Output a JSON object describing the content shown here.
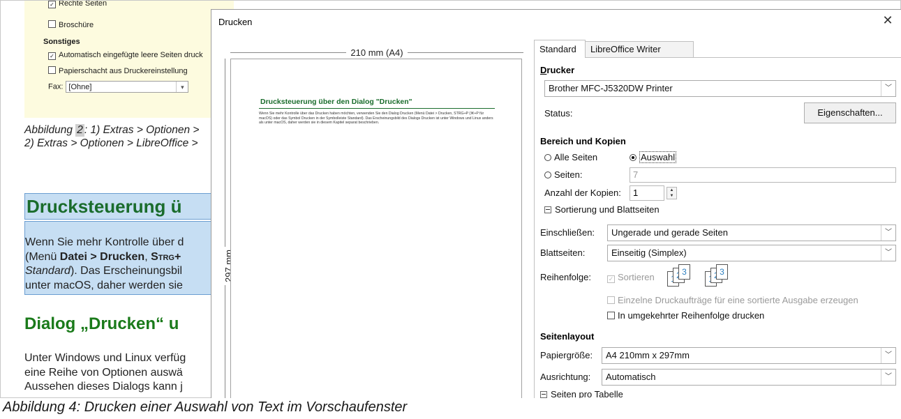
{
  "background_doc": {
    "embedded_options": {
      "right_pages_label": "Rechte Seiten",
      "brochure_label": "Broschüre",
      "misc_heading": "Sonstiges",
      "auto_blank_label": "Automatisch eingefügte leere Seiten druck",
      "paper_tray_label": "Papierschacht aus Druckereinstellung",
      "fax_label": "Fax:",
      "fax_value": "[Ohne]"
    },
    "figure2_caption_line1_a": "Abbildung ",
    "figure2_caption_num": "2",
    "figure2_caption_line1_b": ": 1) Extras > Optionen >",
    "figure2_caption_line2": "2) Extras > Optionen > LibreOffice >",
    "heading_drucksteuerung": "Drucksteuerung ü",
    "para_sel_line1": "Wenn Sie mehr Kontrolle über d",
    "para_sel_line2_a": "(Menü ",
    "para_sel_line2_b": "Datei > Drucken",
    "para_sel_line2_c": ", ",
    "para_sel_line2_d": "Strg+",
    "para_sel_line3_a": "Standard",
    "para_sel_line3_b": "). Das Erscheinungsbil",
    "para_sel_line4": "unter macOS, daher werden sie",
    "heading_dialog": "Dialog „Drucken“ u",
    "para_under_line1": "Unter Windows und Linux verfüg",
    "para_under_line2": "eine Reihe von Optionen auswä",
    "para_under_line3": "Aussehen dieses Dialogs kann j"
  },
  "bottom_caption": "Abbildung 4: Drucken einer Auswahl von Text im Vorschaufenster",
  "dialog": {
    "title": "Drucken",
    "close_glyph": "✕",
    "preview": {
      "width_label": "210 mm (A4)",
      "height_label": "297 mm",
      "mini_heading": "Drucksteuerung über den Dialog \"Drucken\"",
      "mini_text": "Wenn Sie mehr Kontrolle über das Drucken haben möchten, verwenden Sie den Dialog Drucken (Menü Datei > Drucken, STRG+P (⌘+P für macOS) oder das Symbol Drucken in der Symbolleiste Standard). Das Erscheinungsbild des Dialogs Drucken ist unter Windows und Linux anders als unter macOS, daher werden sie in diesem Kapitel separat beschrieben."
    },
    "tabs": [
      "Standard",
      "LibreOffice Writer"
    ],
    "printer": {
      "heading": "Drucker",
      "selected": "Brother MFC-J5320DW Printer",
      "status_label": "Status:",
      "properties_button": "Eigenschaften..."
    },
    "range": {
      "heading": "Bereich und Kopien",
      "all_pages": "Alle Seiten",
      "selection": "Auswahl",
      "pages": "Seiten:",
      "pages_value": "7",
      "copies_label": "Anzahl der Kopien:",
      "copies_value": "1",
      "collation_expander": "Sortierung und Blattseiten",
      "include_label": "Einschließen:",
      "include_value": "Ungerade und gerade Seiten",
      "sides_label": "Blattseiten:",
      "sides_value": "Einseitig (Simplex)",
      "order_label": "Reihenfolge:",
      "collate_label": "Sortieren",
      "separate_jobs_label": "Einzelne Druckaufträge für eine sortierte Ausgabe erzeugen",
      "reverse_order_label": "In umgekehrter Reihenfolge drucken"
    },
    "layout": {
      "heading": "Seitenlayout",
      "paper_size_label": "Papiergröße:",
      "paper_size_value": "A4 210mm x 297mm",
      "orientation_label": "Ausrichtung:",
      "orientation_value": "Automatisch",
      "pages_per_sheet_expander": "Seiten pro Tabelle"
    }
  }
}
